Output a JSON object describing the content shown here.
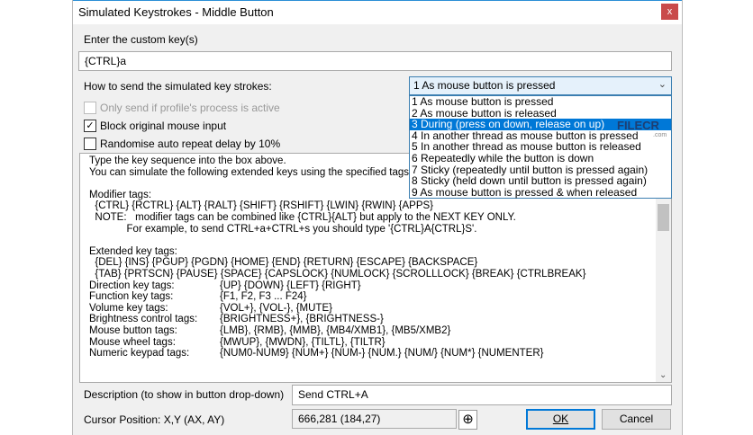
{
  "window": {
    "title": "Simulated Keystrokes - Middle Button",
    "close": "x"
  },
  "custom_key": {
    "label": "Enter the custom key(s)",
    "value": "{CTRL}a"
  },
  "send_mode": {
    "label": "How to send the simulated key strokes:",
    "selected": "1 As mouse button is pressed",
    "options": [
      "1 As mouse button is pressed",
      "2 As mouse button is released",
      "3 During (press on down, release on up)",
      "4 In another thread as mouse button is pressed",
      "5 In another thread as mouse button is released",
      "6 Repeatedly while the button is down",
      "7 Sticky (repeatedly until button is pressed again)",
      "8 Sticky (held down until button is pressed again)",
      "9 As mouse button is pressed & when released"
    ],
    "highlighted_index": 2
  },
  "watermark": {
    "text": "FILECR",
    "sub": ".com"
  },
  "checkboxes": [
    {
      "label": "Only send if profile's process is active",
      "checked": false,
      "disabled": true
    },
    {
      "label": "Block original mouse input",
      "checked": true,
      "disabled": false
    },
    {
      "label": "Randomise auto repeat delay by 10%",
      "checked": false,
      "disabled": false
    }
  ],
  "help": {
    "intro": "Type the key sequence into the box above.\nYou can simulate the following extended keys using the specified tags...\n\nModifier tags:\n  {CTRL} {RCTRL} {ALT} {RALT} {SHIFT} {RSHIFT} {LWIN} {RWIN} {APPS}\n  NOTE:   modifier tags can be combined like {CTRL}{ALT} but apply to the NEXT KEY ONLY.\n             For example, to send CTRL+a+CTRL+s you should type '{CTRL}A{CTRL}S'.\n\nExtended key tags:\n  {DEL} {INS} {PGUP} {PGDN} {HOME} {END} {RETURN} {ESCAPE} {BACKSPACE}\n  {TAB} {PRTSCN} {PAUSE} {SPACE} {CAPSLOCK} {NUMLOCK} {SCROLLLOCK} {BREAK} {CTRLBREAK}\n",
    "rows": [
      [
        "Direction key tags:",
        "{UP} {DOWN} {LEFT} {RIGHT}"
      ],
      [
        "Function key tags:",
        "{F1, F2, F3 ... F24}"
      ],
      [
        "Volume key tags:",
        "{VOL+}, {VOL-}, {MUTE}"
      ],
      [
        "Brightness control tags:",
        "{BRIGHTNESS+}, {BRIGHTNESS-}"
      ],
      [
        "Mouse button tags:",
        "{LMB}, {RMB}, {MMB}, {MB4/XMB1}, {MB5/XMB2}"
      ],
      [
        "Mouse wheel tags:",
        "{MWUP}, {MWDN}, {TILTL}, {TILTR}"
      ],
      [
        "Numeric keypad tags:",
        "{NUM0-NUM9} {NUM+} {NUM-} {NUM.} {NUM/} {NUM*} {NUMENTER}"
      ]
    ]
  },
  "description": {
    "label": "Description (to show in button drop-down)",
    "value": "Send CTRL+A"
  },
  "cursor": {
    "label": "Cursor Position: X,Y (AX, AY)",
    "value": "666,281 (184,27)"
  },
  "buttons": {
    "ok": "OK",
    "cancel": "Cancel"
  }
}
